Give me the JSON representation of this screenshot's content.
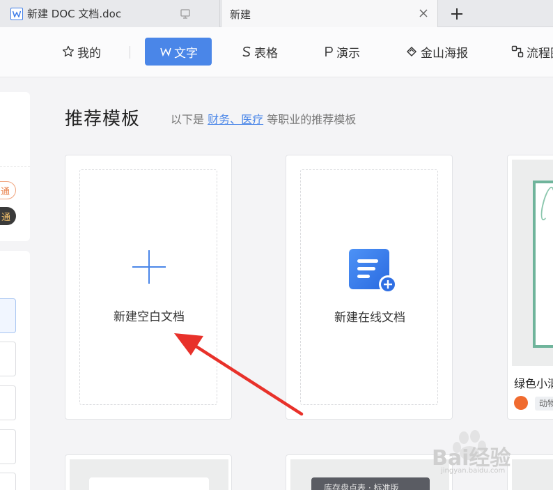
{
  "tabs": [
    {
      "title": "新建 DOC 文档.doc",
      "active": false
    },
    {
      "title": "新建",
      "active": true
    }
  ],
  "nav": {
    "items": [
      {
        "label": "我的",
        "icon": "star-icon"
      },
      {
        "label": "文字",
        "icon": "w-doc-icon",
        "active": true
      },
      {
        "label": "表格",
        "icon": "s-sheet-icon"
      },
      {
        "label": "演示",
        "icon": "p-slide-icon"
      },
      {
        "label": "金山海报",
        "icon": "poster-icon"
      },
      {
        "label": "流程图",
        "icon": "flow-icon"
      }
    ]
  },
  "left_panel": {
    "pill1": "通",
    "pill2": "通"
  },
  "main": {
    "title": "推荐模板",
    "subtitle_prefix": "以下是 ",
    "subtitle_link": "财务、医疗",
    "subtitle_suffix": " 等职业的推荐模板",
    "blank_doc_label": "新建空白文档",
    "online_doc_label": "新建在线文档",
    "template_name": "绿色小清新",
    "template_tag": "动物",
    "row2_banner": "库存盘点表 · 标准版"
  },
  "watermark": {
    "text": "Bai经验",
    "url": "jingyan.baidu.com"
  },
  "colors": {
    "accent": "#4a86e8",
    "annotation": "#e8312a"
  }
}
